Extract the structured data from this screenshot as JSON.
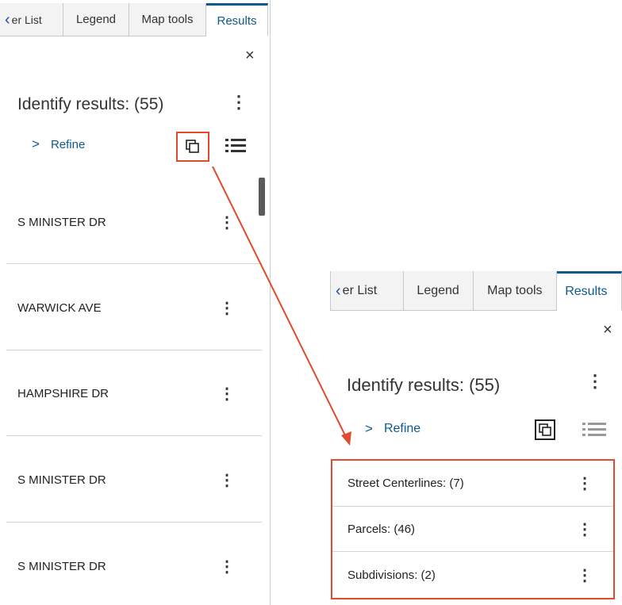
{
  "tabs": {
    "back_label": "er List",
    "legend": "Legend",
    "map_tools": "Map tools",
    "results": "Results"
  },
  "close_glyph": "×",
  "title": "Identify results: (55)",
  "refine": {
    "chevron": ">",
    "label": "Refine"
  },
  "kebab_glyph": "⋮",
  "left_results": [
    "S MINISTER DR",
    "WARWICK AVE",
    "HAMPSHIRE DR",
    "S MINISTER DR",
    "S MINISTER DR"
  ],
  "right_groups": [
    "Street Centerlines: (7)",
    "Parcels: (46)",
    "Subdivisions: (2)"
  ],
  "colors": {
    "accent": "#0d5b8c",
    "highlight": "#e04a2f",
    "back_chevron": "#1b4f9c"
  },
  "icons": {
    "group_view": "group-by-layer-icon",
    "list_view": "list-view-icon",
    "back": "chevron-left-icon"
  }
}
